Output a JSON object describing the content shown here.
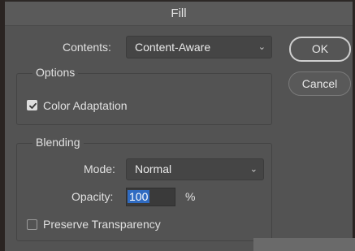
{
  "dialog": {
    "title": "Fill"
  },
  "contents": {
    "label": "Contents:",
    "value": "Content-Aware"
  },
  "buttons": {
    "ok": "OK",
    "cancel": "Cancel"
  },
  "options": {
    "title": "Options",
    "color_adaptation": {
      "label": "Color Adaptation",
      "checked": true
    }
  },
  "blending": {
    "title": "Blending",
    "mode": {
      "label": "Mode:",
      "value": "Normal"
    },
    "opacity": {
      "label": "Opacity:",
      "value": "100",
      "unit": "%"
    },
    "preserve_transparency": {
      "label": "Preserve Transparency",
      "checked": false
    }
  },
  "icons": {
    "chevron": "chevron-down-icon",
    "check": "checkmark-icon"
  },
  "colors": {
    "dialog_bg": "#535353",
    "selection": "#2f6bc2"
  }
}
